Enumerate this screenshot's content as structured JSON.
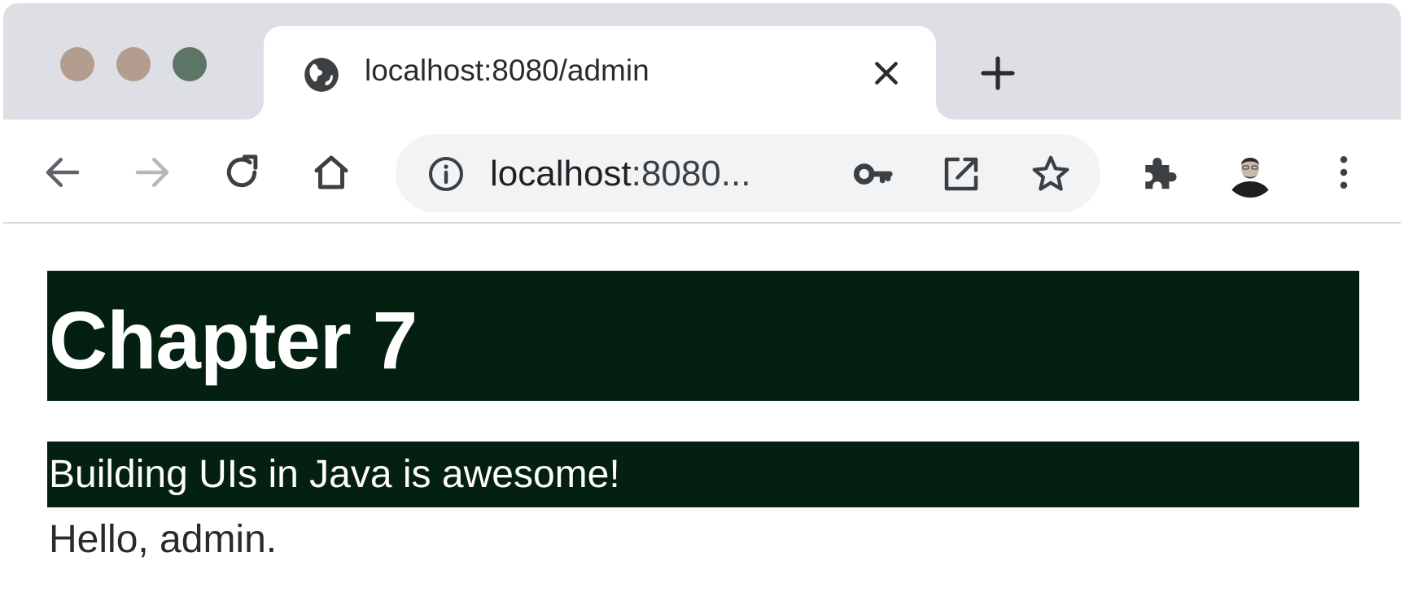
{
  "browser": {
    "tab": {
      "title": "localhost:8080/admin",
      "favicon": "globe-icon"
    },
    "new_tab_icon": "plus-icon",
    "toolbar": {
      "back_icon": "back-arrow-icon",
      "forward_icon": "forward-arrow-icon",
      "reload_icon": "reload-icon",
      "home_icon": "home-icon",
      "omnibox": {
        "info_icon": "info-icon",
        "host": "localhost",
        "rest": ":8080...",
        "key_icon": "key-icon",
        "open_external_icon": "open-in-new-icon",
        "bookmark_icon": "star-icon"
      },
      "extensions_icon": "puzzle-icon",
      "profile": "avatar",
      "menu_icon": "more-vert-icon"
    },
    "colors": {
      "tabstrip": "#dedfe5",
      "traffic_close": "#b39d8e",
      "traffic_minimize": "#b39d8e",
      "traffic_maximize": "#5d7566"
    }
  },
  "page": {
    "heading": "Chapter 7",
    "subheading": "Building UIs in Java is awesome!",
    "greeting": "Hello, admin.",
    "colors": {
      "block_background": "#042010",
      "block_text": "#ffffff",
      "greeting_text": "#2a2a2a"
    }
  }
}
